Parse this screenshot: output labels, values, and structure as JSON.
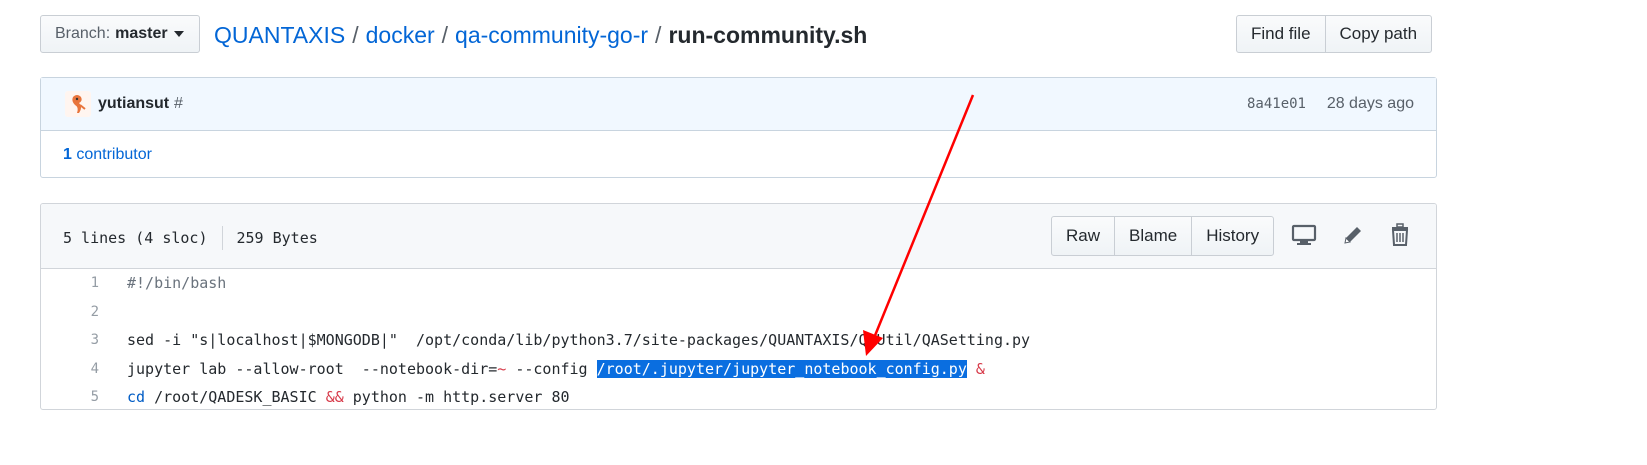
{
  "branch": {
    "prefix": "Branch:",
    "name": "master"
  },
  "breadcrumb": {
    "repo": "QUANTAXIS",
    "dir1": "docker",
    "dir2": "qa-community-go-r",
    "file": "run-community.sh",
    "separator": "/"
  },
  "top_actions": {
    "find_file": "Find file",
    "copy_path": "Copy path"
  },
  "commit": {
    "author": "yutiansut",
    "hash_link": "#",
    "sha": "8a41e01",
    "age": "28 days ago",
    "contributors_count": "1",
    "contributors_label": "contributor"
  },
  "file": {
    "lines_info": "5 lines (4 sloc)",
    "size": "259 Bytes",
    "buttons": {
      "raw": "Raw",
      "blame": "Blame",
      "history": "History"
    },
    "icons": [
      "desktop-icon",
      "pencil-icon",
      "trash-icon"
    ]
  },
  "code_lines": [
    {
      "num": "1",
      "text": "#!/bin/bash"
    },
    {
      "num": "2",
      "text": ""
    },
    {
      "num": "3",
      "text": "sed -i \"s|localhost|$MONGODB|\"  /opt/conda/lib/python3.7/site-packages/QUANTAXIS/QAUtil/QASetting.py"
    },
    {
      "num": "4",
      "p1": "jupyter lab --allow-root  --notebook-dir=",
      "tilde": "~",
      "p2": " --config ",
      "selected": "/root/.jupyter/jupyter_notebook_config.py",
      "amp": "&"
    },
    {
      "num": "5",
      "cd": "cd",
      "p1": " /root/QADESK_BASIC ",
      "andand": "&&",
      "p2": " python -m http.server 80"
    }
  ],
  "colors": {
    "link": "#0366d6",
    "annotation_arrow": "#ff0000",
    "selection": "#0a6ee0"
  }
}
